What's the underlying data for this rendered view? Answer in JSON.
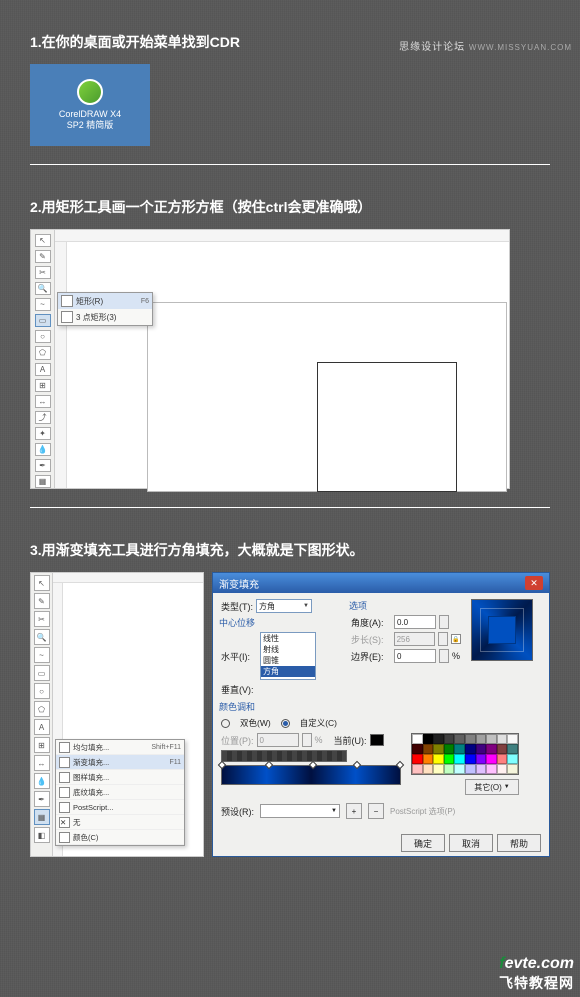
{
  "watermark_top": {
    "site": "思缘设计论坛",
    "url": "WWW.MISSYUAN.COM"
  },
  "steps": {
    "s1": {
      "title": "1.在你的桌面或开始菜单找到CDR",
      "icon_label_1": "CorelDRAW X4",
      "icon_label_2": "SP2 精简版"
    },
    "s2": {
      "title": "2.用矩形工具画一个正方形方框（按住ctrl会更准确哦）",
      "flyout": {
        "row1_label": "矩形(R)",
        "row1_key": "F6",
        "row2_label": "3 点矩形(3)"
      }
    },
    "s3": {
      "title": "3.用渐变填充工具进行方角填充，大概就是下图形状。",
      "fill_flyout": {
        "r1": "均匀填充...",
        "r1k": "Shift+F11",
        "r2": "渐变填充...",
        "r2k": "F11",
        "r3": "图样填充...",
        "r4": "底纹填充...",
        "r5": "PostScript...",
        "r6": "无",
        "r7": "颜色(C)"
      },
      "dialog": {
        "title": "渐变填充",
        "type_label": "类型(T):",
        "type_value": "方角",
        "type_options": {
          "o1": "线性",
          "o2": "射线",
          "o3": "圆锥",
          "o4": "方角"
        },
        "center_label": "中心位移",
        "horiz_label": "水平(I):",
        "vert_label": "垂直(V):",
        "options_label": "选项",
        "angle_label": "角度(A):",
        "angle_val": "0.0",
        "steps_label": "步长(S):",
        "steps_val": "256",
        "edge_label": "边界(E):",
        "edge_val": "0",
        "edge_unit": "%",
        "color_blend_label": "颜色调和",
        "two_color": "双色(W)",
        "custom": "自定义(C)",
        "pos_label": "位置(P):",
        "pos_val": "0",
        "pos_unit": "%",
        "current_label": "当前(U):",
        "other_btn": "其它(O)",
        "preset_label": "预设(R):",
        "postscript": "PostScript 选项(P)",
        "ok": "确定",
        "cancel": "取消",
        "help": "帮助"
      }
    }
  },
  "watermark_bottom": {
    "brand_f": "f",
    "brand_rest": "evte.com",
    "tagline": "飞特教程网"
  },
  "palette_colors": [
    "#ffffff",
    "#000000",
    "#202020",
    "#404040",
    "#606060",
    "#808080",
    "#a0a0a0",
    "#c0c0c0",
    "#e0e0e0",
    "#f8f8f8",
    "#400000",
    "#804000",
    "#808000",
    "#008000",
    "#008080",
    "#000080",
    "#400080",
    "#800080",
    "#804040",
    "#408080",
    "#ff0000",
    "#ff8000",
    "#ffff00",
    "#00ff00",
    "#00ffff",
    "#0000ff",
    "#8000ff",
    "#ff00ff",
    "#ff8080",
    "#80ffff",
    "#ffc0c0",
    "#ffe0c0",
    "#ffffc0",
    "#c0ffc0",
    "#c0ffff",
    "#c0c0ff",
    "#e0c0ff",
    "#ffc0ff",
    "#fff0f0",
    "#f5f5dc"
  ]
}
